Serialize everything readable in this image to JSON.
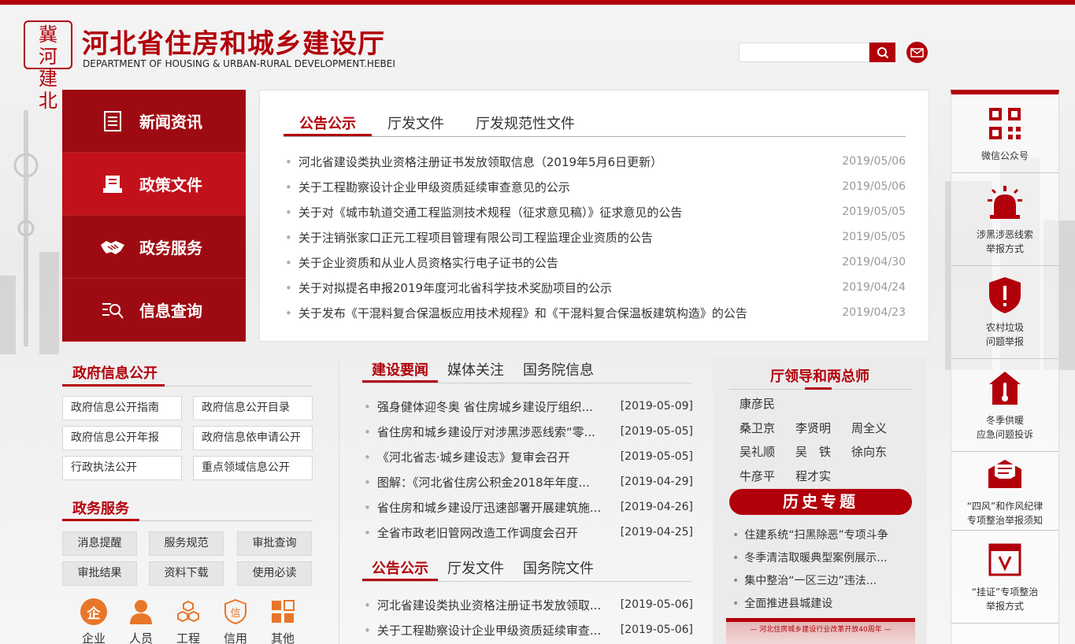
{
  "header": {
    "seal_chars": [
      "冀",
      "河",
      "建",
      "北"
    ],
    "title": "河北省住房和城乡建设厅",
    "subtitle": "DEPARTMENT OF HOUSING & URBAN-RURAL DEVELOPMENT.HEBEI",
    "search": {
      "placeholder": "",
      "value": ""
    }
  },
  "leftnav": [
    {
      "label": "新闻资讯",
      "icon": "document-icon",
      "active": false
    },
    {
      "label": "政策文件",
      "icon": "policy-file-icon",
      "active": true
    },
    {
      "label": "政务服务",
      "icon": "handshake-icon",
      "active": false
    },
    {
      "label": "信息查询",
      "icon": "search-list-icon",
      "active": false
    }
  ],
  "notice_panel": {
    "tabs": [
      {
        "label": "公告公示",
        "active": true
      },
      {
        "label": "厅发文件",
        "active": false
      },
      {
        "label": "厅发规范性文件",
        "active": false
      }
    ],
    "items": [
      {
        "title": "河北省建设类执业资格注册证书发放领取信息（2019年5月6日更新）",
        "date": "2019/05/06"
      },
      {
        "title": "关于工程勘察设计企业甲级资质延续审查意见的公示",
        "date": "2019/05/06"
      },
      {
        "title": "关于对《城市轨道交通工程监测技术规程（征求意见稿）》征求意见的公告",
        "date": "2019/05/05"
      },
      {
        "title": "关于注销张家口正元工程项目管理有限公司工程监理企业资质的公告",
        "date": "2019/05/05"
      },
      {
        "title": "关于企业资质和从业人员资格实行电子证书的公告",
        "date": "2019/04/30"
      },
      {
        "title": "关于对拟提名申报2019年度河北省科学技术奖励项目的公示",
        "date": "2019/04/24"
      },
      {
        "title": "关于发布《干混料复合保温板应用技术规程》和《干混料复合保温板建筑构造》的公告",
        "date": "2019/04/23"
      }
    ]
  },
  "gov_info": {
    "title": "政府信息公开",
    "links": [
      "政府信息公开指南",
      "政府信息公开目录",
      "政府信息公开年报",
      "政府信息依申请公开",
      "行政执法公开",
      "重点领域信息公开"
    ]
  },
  "gov_service": {
    "title": "政务服务",
    "buttons": [
      "消息提醒",
      "服务规范",
      "审批查询",
      "审批结果",
      "资料下载",
      "使用必读"
    ],
    "categories": [
      {
        "label": "企业",
        "icon": "enterprise-icon",
        "glyph": "企"
      },
      {
        "label": "人员",
        "icon": "person-icon",
        "glyph": ""
      },
      {
        "label": "工程",
        "icon": "cubes-icon",
        "glyph": ""
      },
      {
        "label": "信用",
        "icon": "credit-shield-icon",
        "glyph": "信"
      },
      {
        "label": "其他",
        "icon": "grid-icon",
        "glyph": ""
      }
    ]
  },
  "construction_news": {
    "tabs": [
      {
        "label": "建设要闻",
        "active": true
      },
      {
        "label": "媒体关注",
        "active": false
      },
      {
        "label": "国务院信息",
        "active": false
      }
    ],
    "items": [
      {
        "title": "强身健体迎冬奥 省住房城乡建设厅组织...",
        "date": "[2019-05-09]"
      },
      {
        "title": "省住房和城乡建设厅对涉黑涉恶线索“零...",
        "date": "[2019-05-05]"
      },
      {
        "title": "《河北省志·城乡建设志》复审会召开",
        "date": "[2019-05-05]"
      },
      {
        "title": "图解：《河北省住房公积金2018年年度...",
        "date": "[2019-04-29]"
      },
      {
        "title": "省住房和城乡建设厅迅速部署开展建筑施...",
        "date": "[2019-04-26]"
      },
      {
        "title": "全省市政老旧管网改造工作调度会召开",
        "date": "[2019-04-25]"
      }
    ]
  },
  "announcements2": {
    "tabs": [
      {
        "label": "公告公示",
        "active": true
      },
      {
        "label": "厅发文件",
        "active": false
      },
      {
        "label": "国务院文件",
        "active": false
      }
    ],
    "items": [
      {
        "title": "河北省建设类执业资格注册证书发放领取...",
        "date": "[2019-05-06]"
      },
      {
        "title": "关于工程勘察设计企业甲级资质延续审查...",
        "date": "[2019-05-06]"
      }
    ]
  },
  "leaders": {
    "title": "厅领导和两总师",
    "rows": [
      [
        "康彦民"
      ],
      [
        "桑卫京",
        "李贤明",
        "周全义"
      ],
      [
        "吴礼顺",
        "吴　铁",
        "徐向东"
      ],
      [
        "牛彦平",
        "程才实"
      ]
    ]
  },
  "history": {
    "title": "历史专题",
    "items": [
      "住建系统“扫黑除恶”专项斗争",
      "冬季清洁取暖典型案例展示...",
      "集中整治“一区三边”违法...",
      "全面推进县城建设"
    ],
    "banner_text": "— 河北住房城乡建设行业改革开放40周年 —"
  },
  "rightbar": [
    {
      "label_lines": [
        "微信公众号"
      ],
      "icon": "qrcode-icon"
    },
    {
      "label_lines": [
        "涉黑涉恶线索",
        "举报方式"
      ],
      "icon": "alarm-light-icon"
    },
    {
      "label_lines": [
        "农村垃圾",
        "问题举报"
      ],
      "icon": "warning-shield-icon"
    },
    {
      "label_lines": [
        "冬季供暖",
        "应急问题投诉"
      ],
      "icon": "thermometer-house-icon"
    },
    {
      "label_lines": [
        "“四风”和作风纪律",
        "专项整治举报须知"
      ],
      "icon": "envelope-icon"
    },
    {
      "label_lines": [
        "“挂证”专项整治",
        "举报方式"
      ],
      "icon": "certificate-icon"
    }
  ],
  "colors": {
    "brand_red": "#b2000b",
    "nav_dark": "#9e0a12",
    "nav_active": "#c2111b"
  }
}
